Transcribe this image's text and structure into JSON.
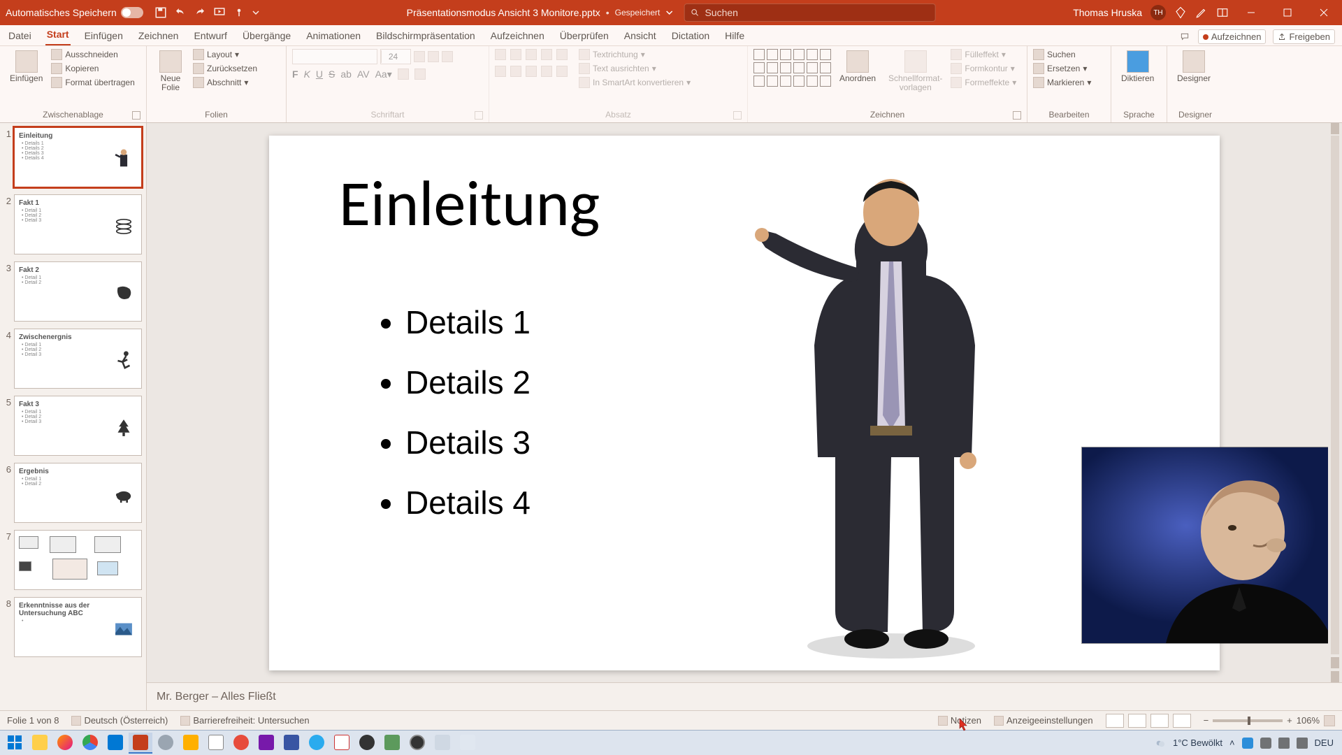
{
  "titlebar": {
    "autosave_label": "Automatisches Speichern",
    "doc_name": "Präsentationsmodus Ansicht 3 Monitore.pptx",
    "saved_label": "Gespeichert",
    "search_placeholder": "Suchen",
    "user_name": "Thomas Hruska",
    "user_initials": "TH"
  },
  "tabs": {
    "items": [
      "Datei",
      "Start",
      "Einfügen",
      "Zeichnen",
      "Entwurf",
      "Übergänge",
      "Animationen",
      "Bildschirmpräsentation",
      "Aufzeichnen",
      "Überprüfen",
      "Ansicht",
      "Dictation",
      "Hilfe"
    ],
    "active_index": 1,
    "record_label": "Aufzeichnen",
    "share_label": "Freigeben"
  },
  "ribbon": {
    "clipboard": {
      "label": "Zwischenablage",
      "paste": "Einfügen",
      "cut": "Ausschneiden",
      "copy": "Kopieren",
      "format_painter": "Format übertragen"
    },
    "slides": {
      "label": "Folien",
      "new_slide": "Neue\nFolie",
      "layout": "Layout",
      "reset": "Zurücksetzen",
      "section": "Abschnitt"
    },
    "font": {
      "label": "Schriftart",
      "size": "24"
    },
    "paragraph": {
      "label": "Absatz",
      "text_direction": "Textrichtung",
      "align_text": "Text ausrichten",
      "convert_smartart": "In SmartArt konvertieren"
    },
    "drawing": {
      "label": "Zeichnen",
      "arrange": "Anordnen",
      "quick_styles": "Schnellformat-\nvorlagen",
      "fill": "Fülleffekt",
      "outline": "Formkontur",
      "effects": "Formeffekte"
    },
    "editing": {
      "label": "Bearbeiten",
      "find": "Suchen",
      "replace": "Ersetzen",
      "select": "Markieren"
    },
    "voice": {
      "label": "Sprache",
      "dictate": "Diktieren"
    },
    "designer": {
      "label": "Designer",
      "btn": "Designer"
    }
  },
  "thumbs": [
    {
      "title": "Einleitung",
      "lines": [
        "Details 1",
        "Details 2",
        "Details 3",
        "Details 4"
      ],
      "icon": "person"
    },
    {
      "title": "Fakt 1",
      "lines": [
        "Detail 1",
        "Detail 2",
        "Detail 3"
      ],
      "icon": "stack"
    },
    {
      "title": "Fakt 2",
      "lines": [
        "Detail 1",
        "Detail 2"
      ],
      "icon": "map"
    },
    {
      "title": "Zwischenergnis",
      "lines": [
        "Detail 1",
        "Detail 2",
        "Detail 3"
      ],
      "icon": "runner"
    },
    {
      "title": "Fakt 3",
      "lines": [
        "Detail 1",
        "Detail 2",
        "Detail 3"
      ],
      "icon": "tree"
    },
    {
      "title": "Ergebnis",
      "lines": [
        "Detail 1",
        "Detail 2"
      ],
      "icon": "piggy"
    },
    {
      "title": "",
      "lines": [],
      "icon": "layout"
    },
    {
      "title": "Erkenntnisse aus der Untersuchung ABC",
      "lines": [
        ""
      ],
      "icon": "photo"
    }
  ],
  "slide": {
    "title": "Einleitung",
    "bullets": [
      "Details 1",
      "Details 2",
      "Details 3",
      "Details 4"
    ]
  },
  "notes": {
    "text": "Mr. Berger – Alles Fließt"
  },
  "status": {
    "slide_of": "Folie 1 von 8",
    "language": "Deutsch (Österreich)",
    "accessibility": "Barrierefreiheit: Untersuchen",
    "notes_btn": "Notizen",
    "display_btn": "Anzeigeeinstellungen",
    "zoom": "106%"
  },
  "taskbar": {
    "weather_temp": "1°C",
    "weather_desc": "Bewölkt",
    "lang": "DEU"
  }
}
